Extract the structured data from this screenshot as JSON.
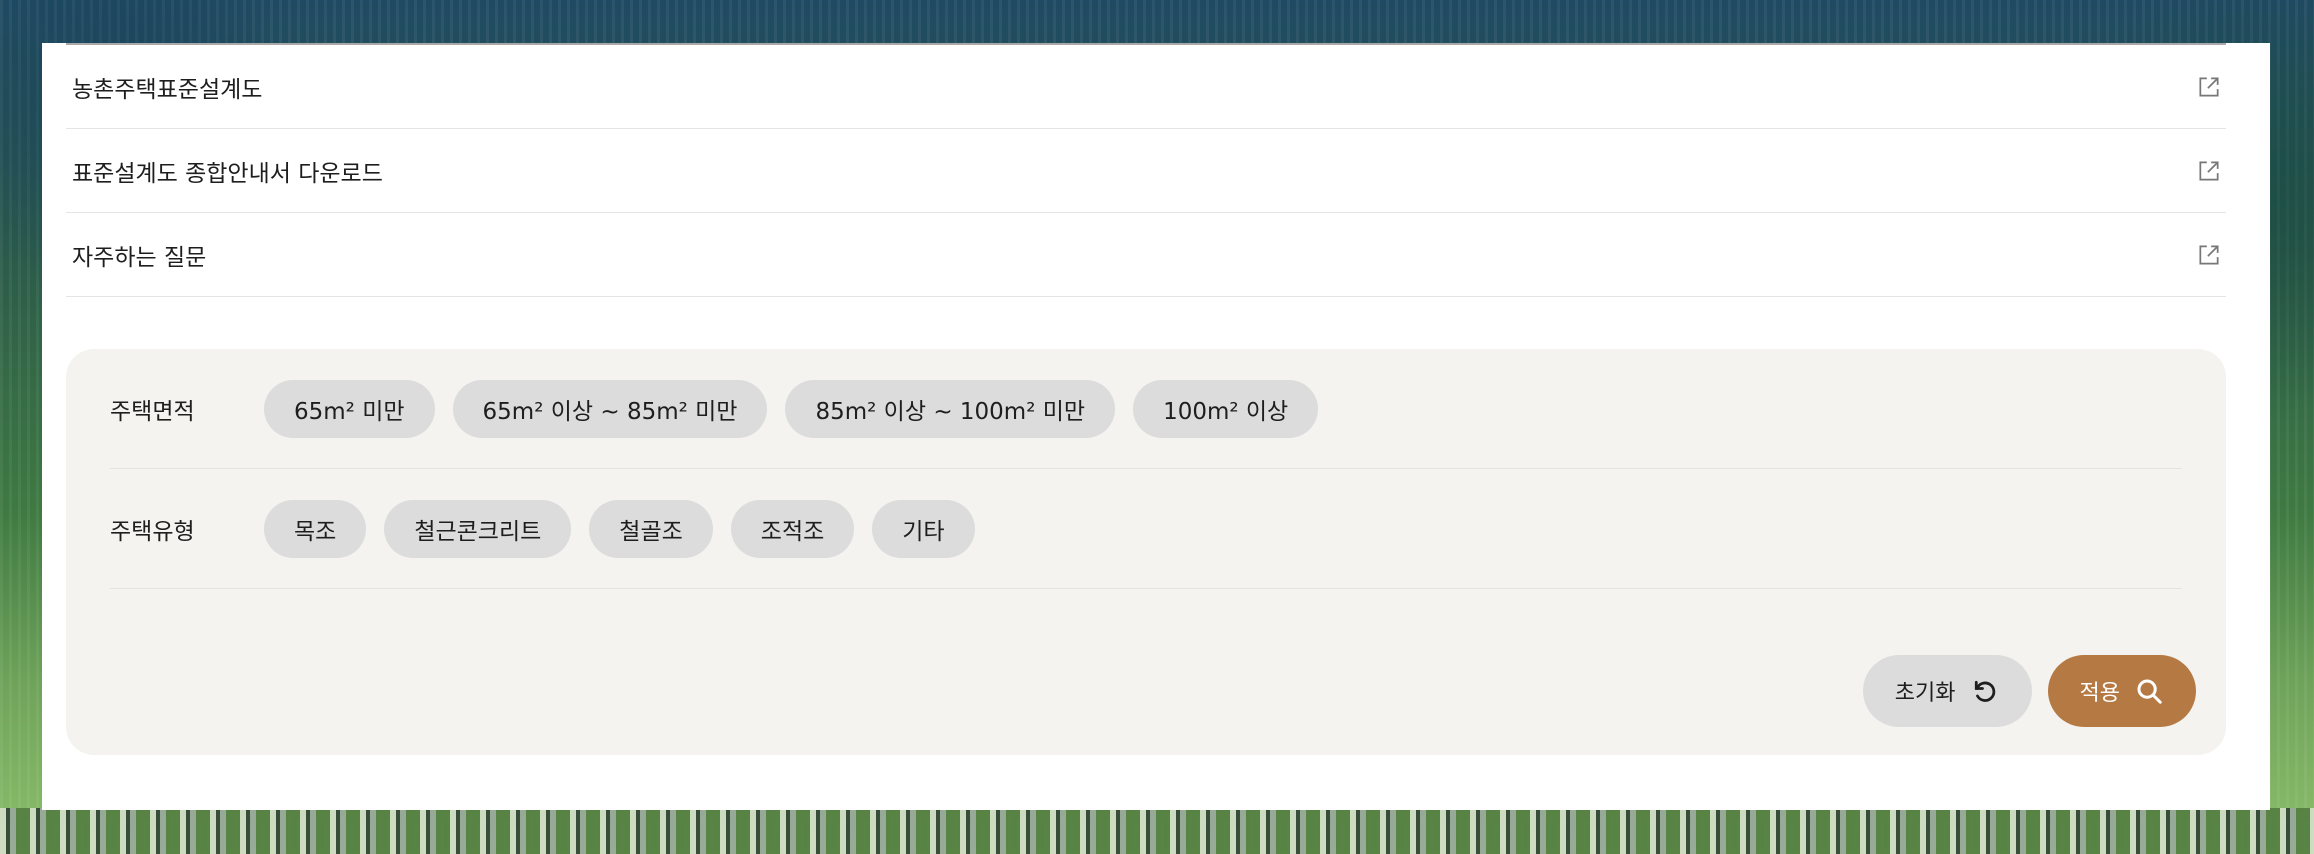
{
  "links": [
    {
      "label": "농촌주택표준설계도",
      "icon": "external-link-icon"
    },
    {
      "label": "표준설계도 종합안내서 다운로드",
      "icon": "external-link-icon"
    },
    {
      "label": "자주하는 질문",
      "icon": "external-link-icon"
    }
  ],
  "filters": {
    "area": {
      "label": "주택면적",
      "options": [
        "65m² 미만",
        "65m² 이상 ~ 85m² 미만",
        "85m² 이상 ~ 100m² 미만",
        "100m² 이상"
      ]
    },
    "type": {
      "label": "주택유형",
      "options": [
        "목조",
        "철근콘크리트",
        "철골조",
        "조적조",
        "기타"
      ]
    }
  },
  "actions": {
    "reset_label": "초기화",
    "reset_icon": "refresh-icon",
    "apply_label": "적용",
    "apply_icon": "search-icon"
  },
  "colors": {
    "apply_button": "#b57944",
    "chip": "#dcdcdc",
    "panel": "#f4f3f0"
  }
}
